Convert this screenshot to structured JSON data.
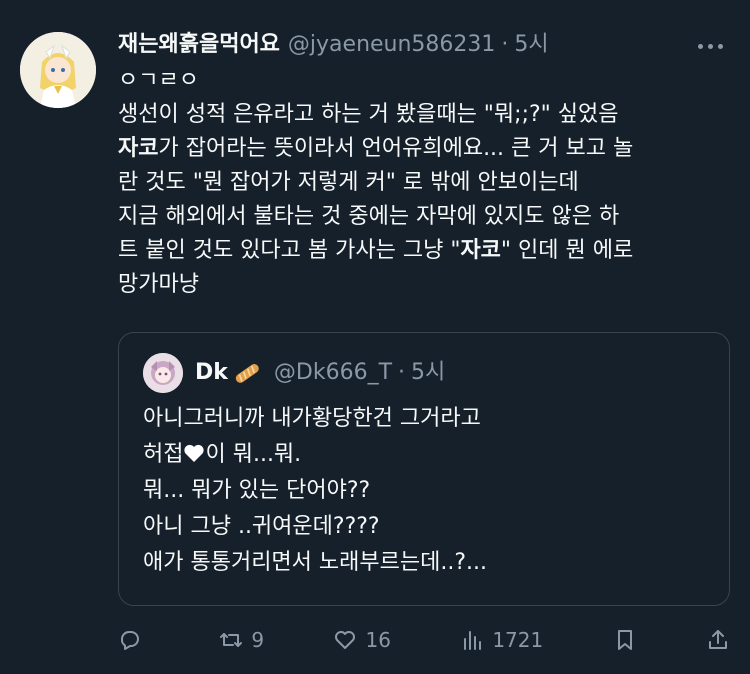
{
  "author": {
    "name": "재는왜흙을먹어요",
    "handle": "@jyaeneun586231",
    "separator": "·",
    "time": "5시"
  },
  "tweet_lines": [
    "ㅇㄱㄹㅇ",
    "생선이 성적 은유라고 하는 거 봤을때는 \"뭐;;?\" 싶었음",
    "자코가 잡어라는 뜻이라서 언어유희에요... 큰 거 보고 놀",
    "란 것도 \"뭔 잡어가 저렇게 커\" 로 밖에 안보이는데",
    "지금 해외에서 불타는 것 중에는 자막에 있지도 않은 하",
    "트 붙인 것도 있다고 봄 가사는 그냥 \"자코\" 인데 뭔 에로",
    "망가마냥"
  ],
  "tweet_bold": {
    "line2_bold": "자코",
    "line2_rest": "가 잡어라는 뜻이라서 언어유희에요... 큰 거 보고 놀",
    "line5_pre": "트 붙인 것도 있다고 봄 가사는 그냥 \"",
    "line5_bold": "자코",
    "line5_post": "\" 인데 뭔 에로"
  },
  "quote": {
    "name": "Dk",
    "handle": "@Dk666_T",
    "separator": "·",
    "time": "5시",
    "line1": "아니그러니까 내가황당한건 그거라고",
    "line2_pre": "허접",
    "line2_post": "이 뭐...뭐.",
    "line3": "뭐... 뭐가 있는 단어야??",
    "line4": "아니 그냥 ..귀여운데????",
    "line5": "애가 통통거리면서 노래부르는데..?..."
  },
  "actions": {
    "reply_count": "",
    "retweet_count": "9",
    "like_count": "16",
    "views_count": "1721"
  },
  "icons": [
    "more-icon",
    "reply-icon",
    "retweet-icon",
    "like-icon",
    "views-icon",
    "bookmark-icon",
    "share-icon",
    "bread-emoji",
    "heart-emoji"
  ],
  "colors": {
    "background": "#15202b",
    "text": "#f7f9f9",
    "secondary": "#8b98a5",
    "border": "#38444d"
  }
}
